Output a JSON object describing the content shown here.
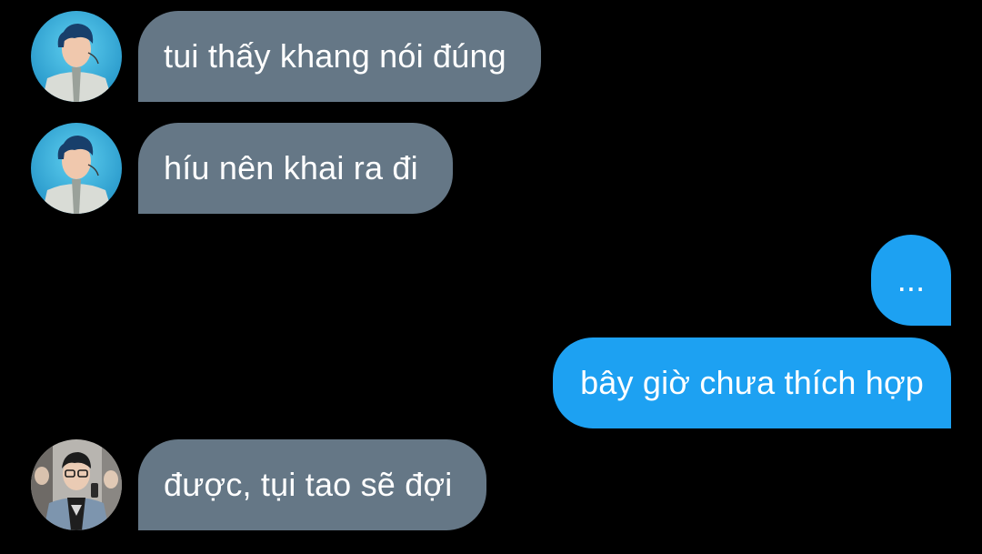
{
  "conversation": {
    "messages": [
      {
        "sender": "other",
        "avatar": "avatar-boy-blue-hair",
        "text": "tui thấy khang nói đúng"
      },
      {
        "sender": "other",
        "avatar": "avatar-boy-blue-hair",
        "text": "híu nên khai ra đi"
      },
      {
        "sender": "me",
        "text": "..."
      },
      {
        "sender": "me",
        "text": "bây giờ chưa thích hợp"
      },
      {
        "sender": "other",
        "avatar": "avatar-boy-glasses",
        "text": "được, tụi tao sẽ đợi"
      }
    ]
  },
  "colors": {
    "background": "#000000",
    "incoming_bubble": "#657786",
    "outgoing_bubble": "#1da1f2",
    "text": "#ffffff"
  }
}
